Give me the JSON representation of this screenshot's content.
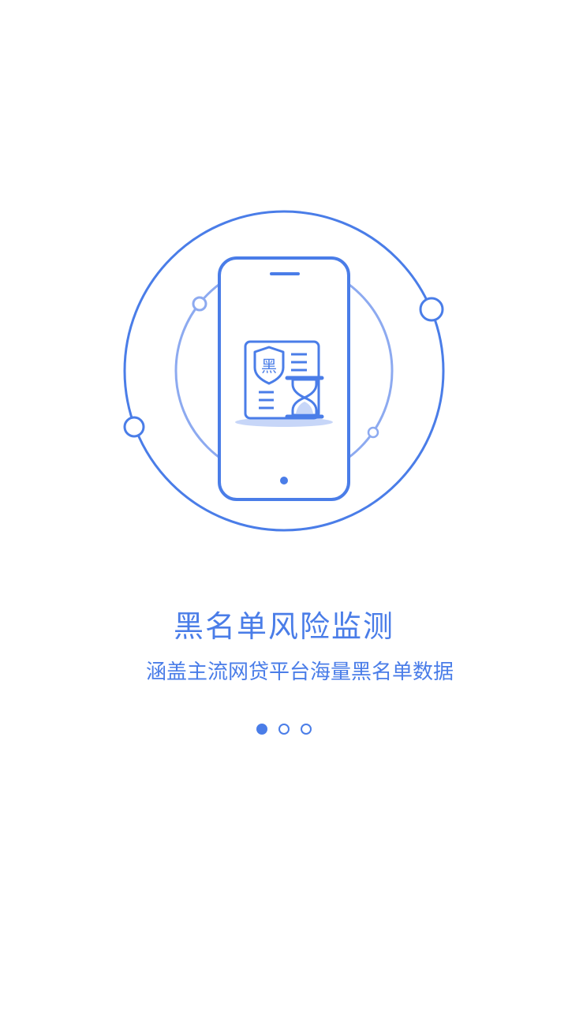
{
  "onboarding": {
    "title": "黑名单风险监测",
    "subtitle": "涵盖主流网贷平台海量黑名单数据",
    "badge_char": "黑",
    "pages_total": 3,
    "active_page": 1
  },
  "colors": {
    "accent": "#4a7de8",
    "accent_light": "#a8c0f5",
    "background": "#ffffff"
  },
  "icons": [
    "phone-icon",
    "blacklist-card-icon",
    "shield-icon",
    "hourglass-icon"
  ]
}
